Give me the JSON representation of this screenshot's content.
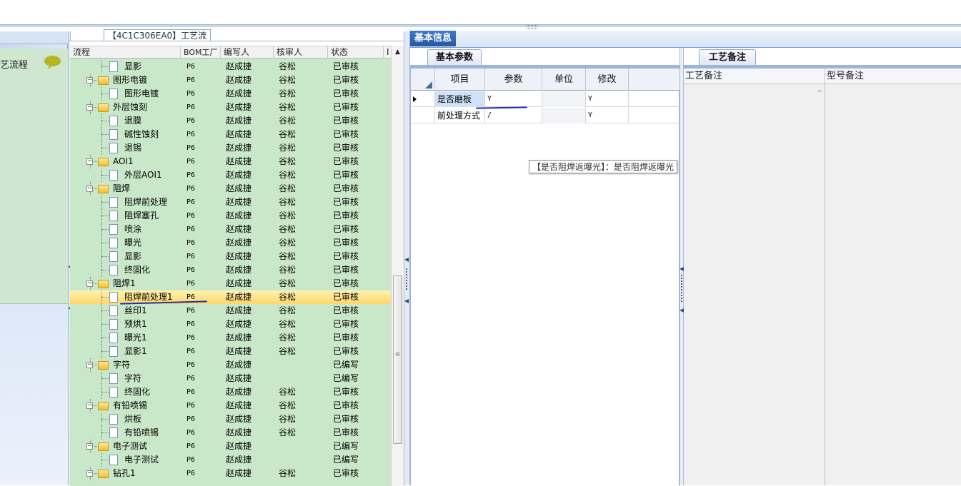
{
  "toolbar": {
    "splitter_grip": "::::::::"
  },
  "left_nav": {
    "item_label": "艺流程",
    "icon": "chat-bubble-icon"
  },
  "tree": {
    "caption": "【4C1C306EA0】工艺流程",
    "columns": [
      "流程",
      "BOM工厂",
      "编写人",
      "核审人",
      "状态",
      "I"
    ],
    "rows": [
      {
        "name": "显影",
        "type": "doc",
        "level": 2,
        "bom": "P6",
        "author": "赵成捷",
        "reviewer": "谷松",
        "status": "已审核"
      },
      {
        "name": "图形电镀",
        "type": "folder",
        "level": 1,
        "bom": "P6",
        "author": "赵成捷",
        "reviewer": "谷松",
        "status": "已审核"
      },
      {
        "name": "图形电镀",
        "type": "doc",
        "level": 2,
        "bom": "P6",
        "author": "赵成捷",
        "reviewer": "谷松",
        "status": "已审核"
      },
      {
        "name": "外层蚀刻",
        "type": "folder",
        "level": 1,
        "bom": "P6",
        "author": "赵成捷",
        "reviewer": "谷松",
        "status": "已审核"
      },
      {
        "name": "退膜",
        "type": "doc",
        "level": 2,
        "bom": "P6",
        "author": "赵成捷",
        "reviewer": "谷松",
        "status": "已审核"
      },
      {
        "name": "碱性蚀刻",
        "type": "doc",
        "level": 2,
        "bom": "P6",
        "author": "赵成捷",
        "reviewer": "谷松",
        "status": "已审核"
      },
      {
        "name": "退锡",
        "type": "doc",
        "level": 2,
        "bom": "P6",
        "author": "赵成捷",
        "reviewer": "谷松",
        "status": "已审核"
      },
      {
        "name": "AOI1",
        "type": "folder",
        "level": 1,
        "bom": "P6",
        "author": "赵成捷",
        "reviewer": "谷松",
        "status": "已审核"
      },
      {
        "name": "外层AOI1",
        "type": "doc",
        "level": 2,
        "bom": "P6",
        "author": "赵成捷",
        "reviewer": "谷松",
        "status": "已审核"
      },
      {
        "name": "阻焊",
        "type": "folder",
        "level": 1,
        "bom": "P6",
        "author": "赵成捷",
        "reviewer": "谷松",
        "status": "已审核"
      },
      {
        "name": "阻焊前处理",
        "type": "doc",
        "level": 2,
        "bom": "P6",
        "author": "赵成捷",
        "reviewer": "谷松",
        "status": "已审核"
      },
      {
        "name": "阻焊塞孔",
        "type": "doc",
        "level": 2,
        "bom": "P6",
        "author": "赵成捷",
        "reviewer": "谷松",
        "status": "已审核"
      },
      {
        "name": "喷涂",
        "type": "doc",
        "level": 2,
        "bom": "P6",
        "author": "赵成捷",
        "reviewer": "谷松",
        "status": "已审核"
      },
      {
        "name": "曝光",
        "type": "doc",
        "level": 2,
        "bom": "P6",
        "author": "赵成捷",
        "reviewer": "谷松",
        "status": "已审核"
      },
      {
        "name": "显影",
        "type": "doc",
        "level": 2,
        "bom": "P6",
        "author": "赵成捷",
        "reviewer": "谷松",
        "status": "已审核"
      },
      {
        "name": "终固化",
        "type": "doc",
        "level": 2,
        "bom": "P6",
        "author": "赵成捷",
        "reviewer": "谷松",
        "status": "已审核"
      },
      {
        "name": "阻焊1",
        "type": "folder",
        "level": 1,
        "bom": "P6",
        "author": "赵成捷",
        "reviewer": "谷松",
        "status": "已审核"
      },
      {
        "name": "阻焊前处理1",
        "type": "doc",
        "level": 2,
        "bom": "P6",
        "author": "赵成捷",
        "reviewer": "谷松",
        "status": "已审核",
        "selected": true
      },
      {
        "name": "丝印1",
        "type": "doc",
        "level": 2,
        "bom": "P6",
        "author": "赵成捷",
        "reviewer": "谷松",
        "status": "已审核"
      },
      {
        "name": "预烘1",
        "type": "doc",
        "level": 2,
        "bom": "P6",
        "author": "赵成捷",
        "reviewer": "谷松",
        "status": "已审核"
      },
      {
        "name": "曝光1",
        "type": "doc",
        "level": 2,
        "bom": "P6",
        "author": "赵成捷",
        "reviewer": "谷松",
        "status": "已审核"
      },
      {
        "name": "显影1",
        "type": "doc",
        "level": 2,
        "bom": "P6",
        "author": "赵成捷",
        "reviewer": "谷松",
        "status": "已审核"
      },
      {
        "name": "字符",
        "type": "folder",
        "level": 1,
        "bom": "P6",
        "author": "赵成捷",
        "reviewer": "",
        "status": "已编写"
      },
      {
        "name": "字符",
        "type": "doc",
        "level": 2,
        "bom": "P6",
        "author": "赵成捷",
        "reviewer": "",
        "status": "已编写"
      },
      {
        "name": "终固化",
        "type": "doc",
        "level": 2,
        "bom": "P6",
        "author": "赵成捷",
        "reviewer": "谷松",
        "status": "已审核"
      },
      {
        "name": "有铅喷锡",
        "type": "folder",
        "level": 1,
        "bom": "P6",
        "author": "赵成捷",
        "reviewer": "谷松",
        "status": "已审核"
      },
      {
        "name": "烘板",
        "type": "doc",
        "level": 2,
        "bom": "P6",
        "author": "赵成捷",
        "reviewer": "谷松",
        "status": "已审核"
      },
      {
        "name": "有铅喷锡",
        "type": "doc",
        "level": 2,
        "bom": "P6",
        "author": "赵成捷",
        "reviewer": "谷松",
        "status": "已审核"
      },
      {
        "name": "电子测试",
        "type": "folder",
        "level": 1,
        "bom": "P6",
        "author": "赵成捷",
        "reviewer": "",
        "status": "已编写"
      },
      {
        "name": "电子测试",
        "type": "doc",
        "level": 2,
        "bom": "P6",
        "author": "赵成捷",
        "reviewer": "",
        "status": "已编写"
      },
      {
        "name": "钻孔1",
        "type": "folder",
        "level": 1,
        "bom": "P6",
        "author": "赵成捷",
        "reviewer": "谷松",
        "status": "已审核"
      }
    ]
  },
  "basic_info": {
    "tab_label": "基本信息",
    "sub_tab_label": "基本参数",
    "columns": [
      "项目",
      "参数",
      "单位",
      "修改"
    ],
    "rows": [
      {
        "item": "是否磨板",
        "param": "Y",
        "unit": "",
        "modify": "Y"
      },
      {
        "item": "前处理方式",
        "param": "/",
        "unit": "",
        "modify": "Y"
      }
    ],
    "tooltip": "【是否阻焊返曝光】：是否阻焊返曝光"
  },
  "remarks": {
    "tab_label": "工艺备注",
    "columns": [
      "工艺备注",
      "型号备注"
    ]
  },
  "colors": {
    "tree_bg": "#c9e8c9",
    "selection": "#ffd768",
    "tab_blue": "#2458a4",
    "ink_marks": "#1c2fb8"
  }
}
